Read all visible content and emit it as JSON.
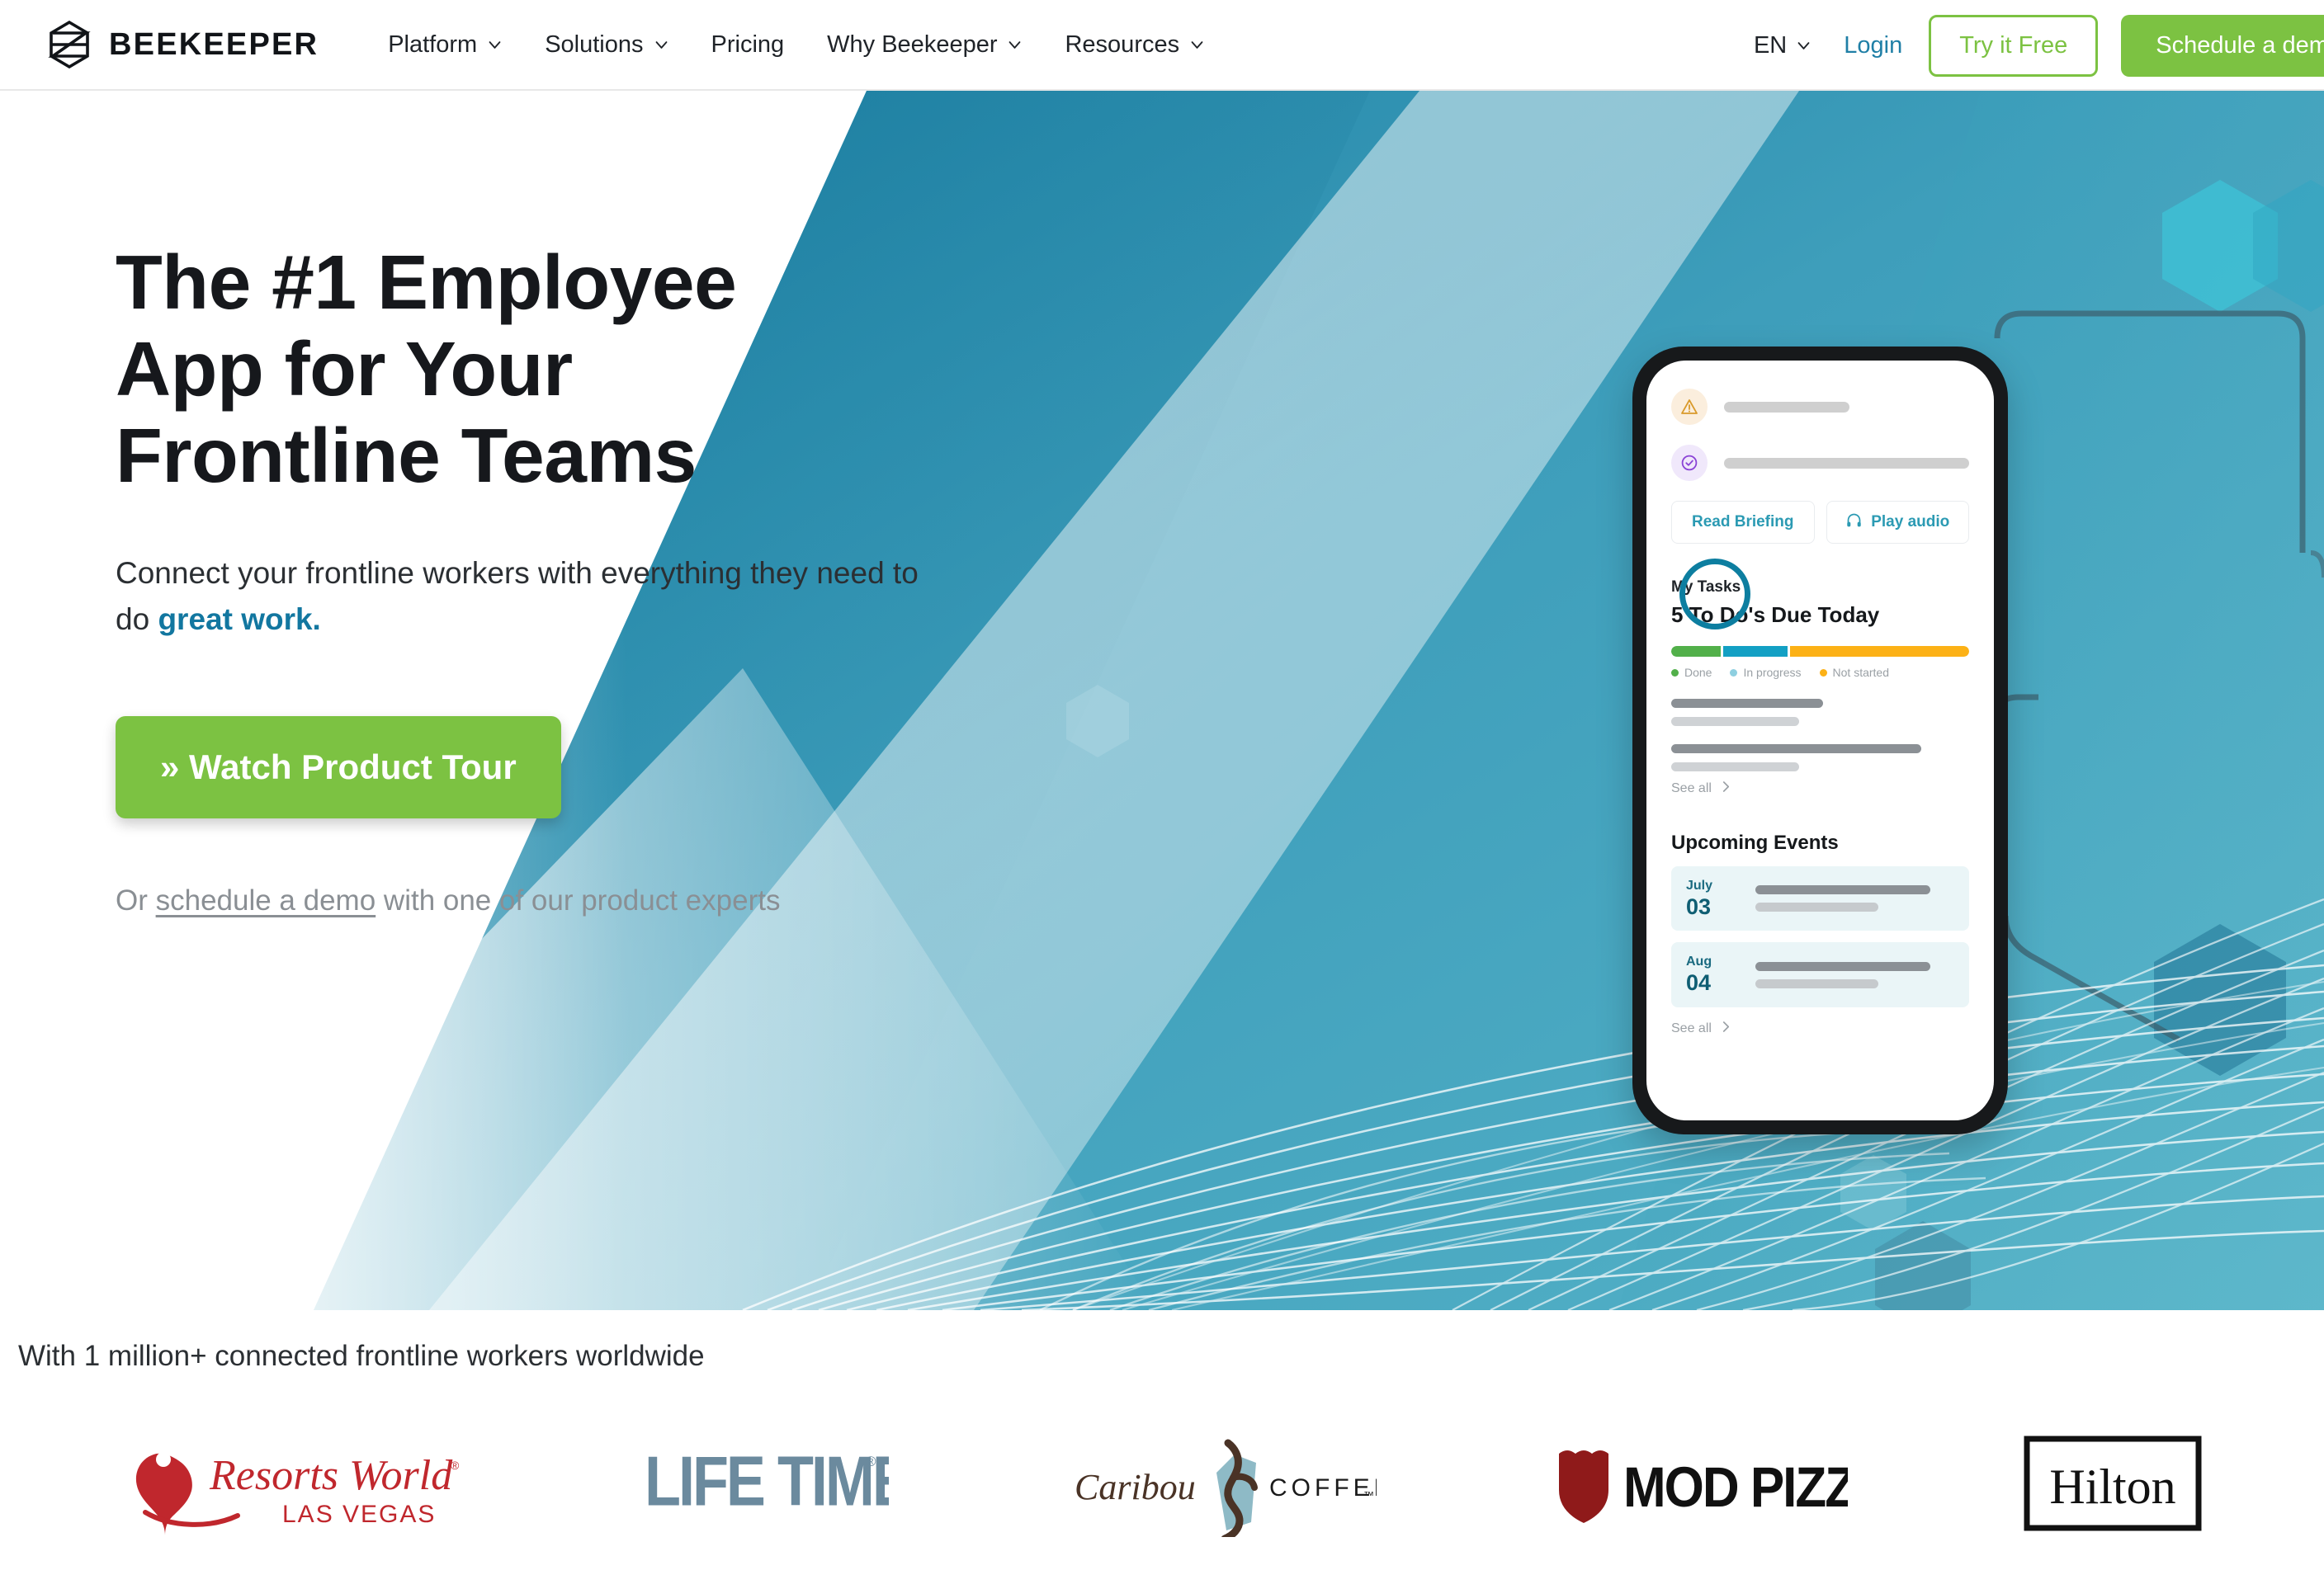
{
  "nav": {
    "brand": "BEEKEEPER",
    "brand_icon": "beekeeper-hexagon-logo",
    "links": [
      {
        "label": "Platform",
        "has_caret": true
      },
      {
        "label": "Solutions",
        "has_caret": true
      },
      {
        "label": "Pricing",
        "has_caret": false
      },
      {
        "label": "Why Beekeeper",
        "has_caret": true
      },
      {
        "label": "Resources",
        "has_caret": true
      }
    ],
    "language": "EN",
    "login": "Login",
    "try_free": "Try it Free",
    "schedule_demo": "Schedule a demo"
  },
  "hero": {
    "title_line1": "The #1 Employee",
    "title_line2": "App for Your",
    "title_line3": "Frontline Teams",
    "subtitle_lead": "Connect your frontline workers with everything they need to do ",
    "subtitle_highlight": "great work.",
    "cta_label": "» Watch Product Tour",
    "sub_cta_prefix": "Or ",
    "sub_cta_link": "schedule a demo",
    "sub_cta_suffix": " with one of our product experts"
  },
  "phone": {
    "notifications": [
      {
        "icon": "warning-triangle-icon"
      },
      {
        "icon": "check-circle-icon"
      }
    ],
    "chips": [
      {
        "label": "Read Briefing",
        "icon": null
      },
      {
        "label": "Play audio",
        "icon": "headphones-icon"
      }
    ],
    "tasks": {
      "section_label": "My Tasks",
      "headline": "5 To Do's Due Today",
      "legend": [
        {
          "label": "Done",
          "color": "#52b04a",
          "percent": 17
        },
        {
          "label": "In progress",
          "color": "#8ecfe0",
          "percent": 22
        },
        {
          "label": "Not started",
          "color": "#fcb116",
          "percent": 61
        }
      ],
      "see_all": "See all"
    },
    "events": {
      "title": "Upcoming Events",
      "items": [
        {
          "month": "July",
          "day": "03"
        },
        {
          "month": "Aug",
          "day": "04"
        }
      ],
      "see_all": "See all"
    }
  },
  "social_proof": {
    "caption": "With 1 million+ connected frontline workers worldwide",
    "logos": [
      {
        "name": "Resorts World Las Vegas",
        "line1": "Resorts World",
        "line2": "LAS VEGAS",
        "color": "#c0272d"
      },
      {
        "name": "LIFE TIME",
        "line1": "LIFE TIME",
        "color": "#6b8a9e"
      },
      {
        "name": "Caribou Coffee",
        "line1": "Caribou",
        "line2": "COFFEE",
        "color": "#4a3326"
      },
      {
        "name": "MOD PIZZA",
        "line1": "MOD PIZZA",
        "color": "#8f1a1a"
      },
      {
        "name": "Hilton",
        "line1": "Hilton",
        "color": "#111111"
      }
    ]
  },
  "colors": {
    "brand_green": "#7cc242",
    "brand_teal": "#1277a0",
    "hero_blue_dark": "#1b7fa3",
    "hero_blue_mid": "#4ba6c0",
    "hero_blue_light": "#7cc0d3"
  }
}
